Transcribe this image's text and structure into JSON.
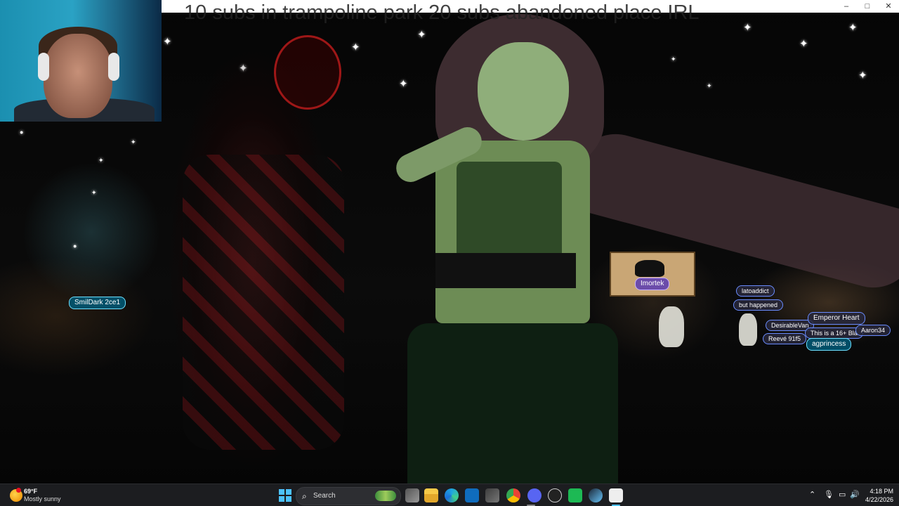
{
  "stream_title": "10 subs in trampoline park 20 subs abandoned place IRL",
  "window_controls": {
    "minimize": "–",
    "maximize": "□",
    "close": "✕"
  },
  "nameplates": {
    "left": "SmilDark 2ce1",
    "screen": "Imortek",
    "tag1": "latoaddict",
    "tag2": "but happened",
    "tag3": "DesirableVan",
    "emperor": "Emperor Heart",
    "tag5": "This is a 16+ Bla",
    "aaron": "Aaron34",
    "reeve": "Reevé 91f5",
    "princess": "agprincess"
  },
  "taskbar": {
    "weather_temp": "69°F",
    "weather_condition": "Mostly sunny",
    "search_placeholder": "Search",
    "time": "4:18 PM",
    "date": "4/22/2026"
  },
  "icons": [
    "windows-start-icon",
    "search-icon",
    "task-view-icon",
    "file-explorer-icon",
    "edge-icon",
    "outlook-icon",
    "store-icon",
    "chrome-icon",
    "discord-icon",
    "obs-icon",
    "spotify-like-icon",
    "steam-icon",
    "vrchat-icon",
    "chevron-up-icon",
    "microphone-icon",
    "network-icon",
    "volume-icon",
    "weather-icon"
  ],
  "colors": {
    "taskbar_bg": "#1c1d20",
    "accent": "#4cc2ff",
    "discord": "#5865f2"
  }
}
